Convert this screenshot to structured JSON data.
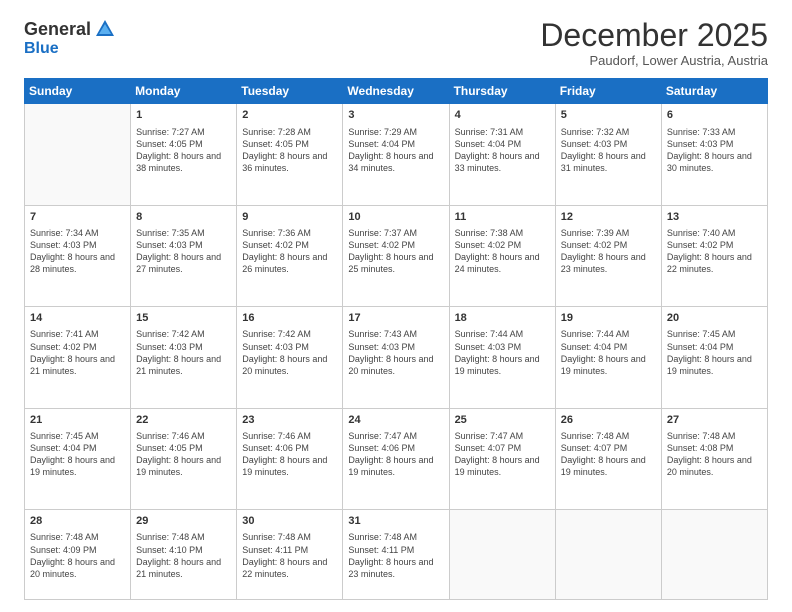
{
  "logo": {
    "general": "General",
    "blue": "Blue"
  },
  "header": {
    "month": "December 2025",
    "location": "Paudorf, Lower Austria, Austria"
  },
  "weekdays": [
    "Sunday",
    "Monday",
    "Tuesday",
    "Wednesday",
    "Thursday",
    "Friday",
    "Saturday"
  ],
  "weeks": [
    [
      {
        "day": "",
        "sunrise": "",
        "sunset": "",
        "daylight": ""
      },
      {
        "day": "1",
        "sunrise": "Sunrise: 7:27 AM",
        "sunset": "Sunset: 4:05 PM",
        "daylight": "Daylight: 8 hours and 38 minutes."
      },
      {
        "day": "2",
        "sunrise": "Sunrise: 7:28 AM",
        "sunset": "Sunset: 4:05 PM",
        "daylight": "Daylight: 8 hours and 36 minutes."
      },
      {
        "day": "3",
        "sunrise": "Sunrise: 7:29 AM",
        "sunset": "Sunset: 4:04 PM",
        "daylight": "Daylight: 8 hours and 34 minutes."
      },
      {
        "day": "4",
        "sunrise": "Sunrise: 7:31 AM",
        "sunset": "Sunset: 4:04 PM",
        "daylight": "Daylight: 8 hours and 33 minutes."
      },
      {
        "day": "5",
        "sunrise": "Sunrise: 7:32 AM",
        "sunset": "Sunset: 4:03 PM",
        "daylight": "Daylight: 8 hours and 31 minutes."
      },
      {
        "day": "6",
        "sunrise": "Sunrise: 7:33 AM",
        "sunset": "Sunset: 4:03 PM",
        "daylight": "Daylight: 8 hours and 30 minutes."
      }
    ],
    [
      {
        "day": "7",
        "sunrise": "Sunrise: 7:34 AM",
        "sunset": "Sunset: 4:03 PM",
        "daylight": "Daylight: 8 hours and 28 minutes."
      },
      {
        "day": "8",
        "sunrise": "Sunrise: 7:35 AM",
        "sunset": "Sunset: 4:03 PM",
        "daylight": "Daylight: 8 hours and 27 minutes."
      },
      {
        "day": "9",
        "sunrise": "Sunrise: 7:36 AM",
        "sunset": "Sunset: 4:02 PM",
        "daylight": "Daylight: 8 hours and 26 minutes."
      },
      {
        "day": "10",
        "sunrise": "Sunrise: 7:37 AM",
        "sunset": "Sunset: 4:02 PM",
        "daylight": "Daylight: 8 hours and 25 minutes."
      },
      {
        "day": "11",
        "sunrise": "Sunrise: 7:38 AM",
        "sunset": "Sunset: 4:02 PM",
        "daylight": "Daylight: 8 hours and 24 minutes."
      },
      {
        "day": "12",
        "sunrise": "Sunrise: 7:39 AM",
        "sunset": "Sunset: 4:02 PM",
        "daylight": "Daylight: 8 hours and 23 minutes."
      },
      {
        "day": "13",
        "sunrise": "Sunrise: 7:40 AM",
        "sunset": "Sunset: 4:02 PM",
        "daylight": "Daylight: 8 hours and 22 minutes."
      }
    ],
    [
      {
        "day": "14",
        "sunrise": "Sunrise: 7:41 AM",
        "sunset": "Sunset: 4:02 PM",
        "daylight": "Daylight: 8 hours and 21 minutes."
      },
      {
        "day": "15",
        "sunrise": "Sunrise: 7:42 AM",
        "sunset": "Sunset: 4:03 PM",
        "daylight": "Daylight: 8 hours and 21 minutes."
      },
      {
        "day": "16",
        "sunrise": "Sunrise: 7:42 AM",
        "sunset": "Sunset: 4:03 PM",
        "daylight": "Daylight: 8 hours and 20 minutes."
      },
      {
        "day": "17",
        "sunrise": "Sunrise: 7:43 AM",
        "sunset": "Sunset: 4:03 PM",
        "daylight": "Daylight: 8 hours and 20 minutes."
      },
      {
        "day": "18",
        "sunrise": "Sunrise: 7:44 AM",
        "sunset": "Sunset: 4:03 PM",
        "daylight": "Daylight: 8 hours and 19 minutes."
      },
      {
        "day": "19",
        "sunrise": "Sunrise: 7:44 AM",
        "sunset": "Sunset: 4:04 PM",
        "daylight": "Daylight: 8 hours and 19 minutes."
      },
      {
        "day": "20",
        "sunrise": "Sunrise: 7:45 AM",
        "sunset": "Sunset: 4:04 PM",
        "daylight": "Daylight: 8 hours and 19 minutes."
      }
    ],
    [
      {
        "day": "21",
        "sunrise": "Sunrise: 7:45 AM",
        "sunset": "Sunset: 4:04 PM",
        "daylight": "Daylight: 8 hours and 19 minutes."
      },
      {
        "day": "22",
        "sunrise": "Sunrise: 7:46 AM",
        "sunset": "Sunset: 4:05 PM",
        "daylight": "Daylight: 8 hours and 19 minutes."
      },
      {
        "day": "23",
        "sunrise": "Sunrise: 7:46 AM",
        "sunset": "Sunset: 4:06 PM",
        "daylight": "Daylight: 8 hours and 19 minutes."
      },
      {
        "day": "24",
        "sunrise": "Sunrise: 7:47 AM",
        "sunset": "Sunset: 4:06 PM",
        "daylight": "Daylight: 8 hours and 19 minutes."
      },
      {
        "day": "25",
        "sunrise": "Sunrise: 7:47 AM",
        "sunset": "Sunset: 4:07 PM",
        "daylight": "Daylight: 8 hours and 19 minutes."
      },
      {
        "day": "26",
        "sunrise": "Sunrise: 7:48 AM",
        "sunset": "Sunset: 4:07 PM",
        "daylight": "Daylight: 8 hours and 19 minutes."
      },
      {
        "day": "27",
        "sunrise": "Sunrise: 7:48 AM",
        "sunset": "Sunset: 4:08 PM",
        "daylight": "Daylight: 8 hours and 20 minutes."
      }
    ],
    [
      {
        "day": "28",
        "sunrise": "Sunrise: 7:48 AM",
        "sunset": "Sunset: 4:09 PM",
        "daylight": "Daylight: 8 hours and 20 minutes."
      },
      {
        "day": "29",
        "sunrise": "Sunrise: 7:48 AM",
        "sunset": "Sunset: 4:10 PM",
        "daylight": "Daylight: 8 hours and 21 minutes."
      },
      {
        "day": "30",
        "sunrise": "Sunrise: 7:48 AM",
        "sunset": "Sunset: 4:11 PM",
        "daylight": "Daylight: 8 hours and 22 minutes."
      },
      {
        "day": "31",
        "sunrise": "Sunrise: 7:48 AM",
        "sunset": "Sunset: 4:11 PM",
        "daylight": "Daylight: 8 hours and 23 minutes."
      },
      {
        "day": "",
        "sunrise": "",
        "sunset": "",
        "daylight": ""
      },
      {
        "day": "",
        "sunrise": "",
        "sunset": "",
        "daylight": ""
      },
      {
        "day": "",
        "sunrise": "",
        "sunset": "",
        "daylight": ""
      }
    ]
  ]
}
